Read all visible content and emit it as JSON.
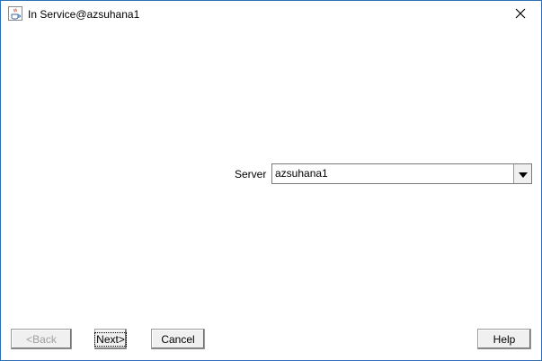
{
  "window": {
    "title": "In Service@azsuhana1",
    "app_icon": "java-cup-icon",
    "close_icon": "close-icon"
  },
  "form": {
    "server_label": "Server",
    "server_value": "azsuhana1",
    "dropdown_icon": "chevron-down-icon"
  },
  "buttons": {
    "back_label": "<Back",
    "next_label": "Next>",
    "cancel_label": "Cancel",
    "help_label": "Help"
  },
  "colors": {
    "window_border": "#2f6fb5",
    "button_face": "#f0f0f0",
    "disabled_text": "#a0a0a0"
  }
}
